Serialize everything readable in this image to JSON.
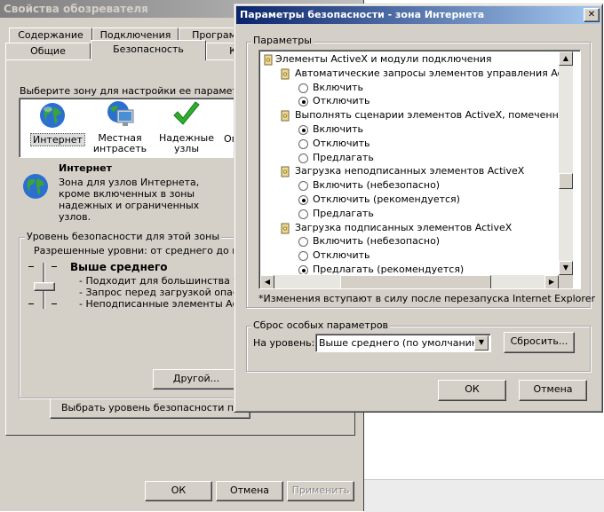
{
  "back_window": {
    "title": "Свойства обозревателя",
    "tabs_row1": [
      "Содержание",
      "Подключения",
      "Програм"
    ],
    "tabs_row2": [
      "Общие",
      "Безопасность",
      "К"
    ],
    "zone_prompt": "Выберите зону для настройки ее параметров б",
    "zones": [
      {
        "label": "Интернет",
        "icon": "globe-icon"
      },
      {
        "label": "Местная интрасеть",
        "icon": "monitor-icon"
      },
      {
        "label": "Надежные узлы",
        "icon": "checkmark-icon"
      },
      {
        "label": "Оп",
        "icon": "none"
      }
    ],
    "zone_title": "Интернет",
    "zone_desc": "Зона для узлов Интернета, кроме включенных в зоны надежных и ограниченных узлов.",
    "level_group_title": "Уровень безопасности для этой зоны",
    "allowed_levels": "Разрешенные уровни: от среднего до высо",
    "level_name": "Выше среднего",
    "level_bullets": [
      "- Подходит для большинства узл",
      "- Запрос перед загрузкой опасно",
      "- Неподписанные элементы Active"
    ],
    "other_button": "Другой...",
    "default_level_button": "Выбрать уровень безопасности по умо",
    "ok": "ОК",
    "cancel": "Отмена",
    "apply": "Применить"
  },
  "dialog": {
    "title": "Параметры безопасности - зона Интернета",
    "close_glyph": "✕",
    "params_group": "Параметры",
    "tree": [
      {
        "type": "category",
        "text": "Элементы ActiveX и модули подключения"
      },
      {
        "type": "setting",
        "text": "Автоматические запросы элементов управления ActiveX"
      },
      {
        "type": "option",
        "text": "Включить",
        "selected": false
      },
      {
        "type": "option",
        "text": "Отключить",
        "selected": true
      },
      {
        "type": "setting",
        "text": "Выполнять сценарии элементов ActiveX, помеченные как"
      },
      {
        "type": "option",
        "text": "Включить",
        "selected": true
      },
      {
        "type": "option",
        "text": "Отключить",
        "selected": false
      },
      {
        "type": "option",
        "text": "Предлагать",
        "selected": false
      },
      {
        "type": "setting",
        "text": "Загрузка неподписанных элементов ActiveX"
      },
      {
        "type": "option",
        "text": "Включить (небезопасно)",
        "selected": false
      },
      {
        "type": "option",
        "text": "Отключить (рекомендуется)",
        "selected": true
      },
      {
        "type": "option",
        "text": "Предлагать",
        "selected": false
      },
      {
        "type": "setting",
        "text": "Загрузка подписанных элементов ActiveX"
      },
      {
        "type": "option",
        "text": "Включить (небезопасно)",
        "selected": false
      },
      {
        "type": "option",
        "text": "Отключить",
        "selected": false
      },
      {
        "type": "option",
        "text": "Предлагать (рекомендуется)",
        "selected": true
      }
    ],
    "note": "*Изменения вступают в силу после перезапуска Internet Explorer",
    "reset_group": "Сброс особых параметров",
    "reset_label": "На уровень:",
    "reset_value": "Выше среднего (по умолчанию)",
    "reset_button": "Сбросить...",
    "ok": "ОК",
    "cancel": "Отмена",
    "vscroll_position": 0.6,
    "hscroll_position": 0.55
  },
  "colors": {
    "face": "#d4d0c8",
    "active_title_start": "#0a246a",
    "active_title_end": "#a6caf0",
    "inactive_title_start": "#808080",
    "inactive_title_end": "#c0c0c0",
    "selection": "#0a246a"
  }
}
